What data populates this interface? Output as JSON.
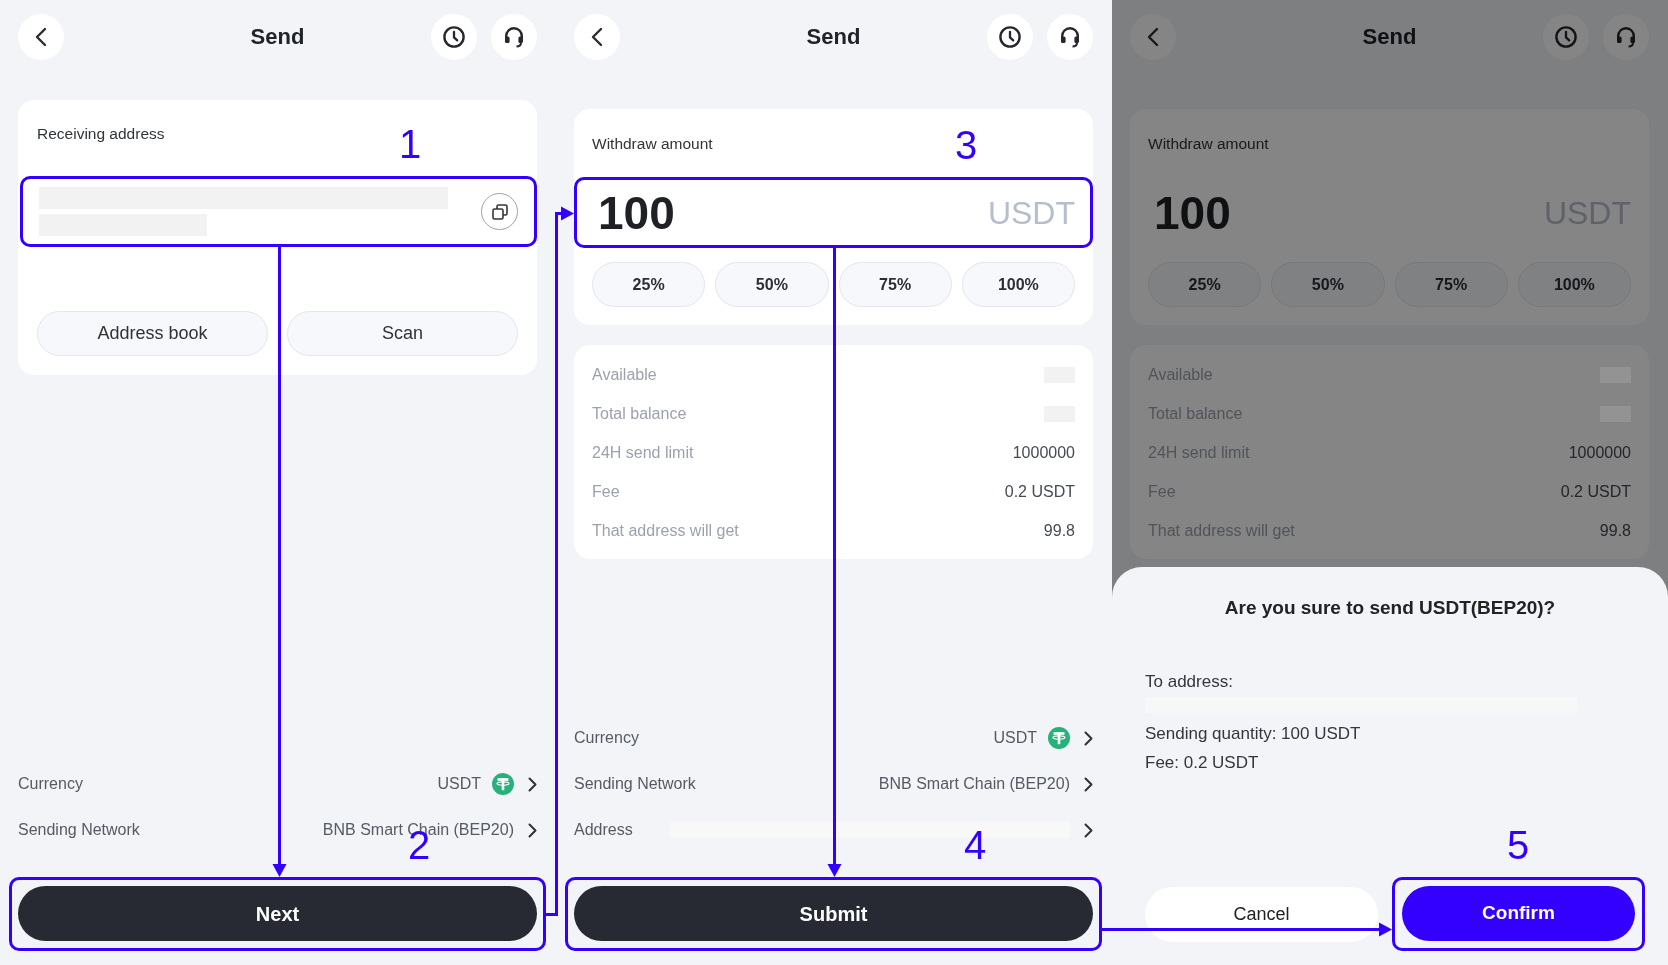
{
  "screens": [
    {
      "dimmed": false,
      "header": {
        "title": "Send"
      },
      "address_card": {
        "label": "Receiving address",
        "field": {
          "redacted": true,
          "step": "1"
        },
        "buttons": [
          "Address book",
          "Scan"
        ]
      },
      "settings": [
        {
          "kind": "coin",
          "label": "Currency",
          "value": "USDT"
        },
        {
          "kind": "text",
          "label": "Sending Network",
          "value": "BNB Smart Chain (BEP20)"
        }
      ],
      "action": {
        "label": "Next",
        "step": "2"
      }
    },
    {
      "dimmed": false,
      "header": {
        "title": "Send"
      },
      "amount_card": {
        "label": "Withdraw amount",
        "value": "100",
        "unit": "USDT",
        "step": "3",
        "presets": [
          "25%",
          "50%",
          "75%",
          "100%"
        ]
      },
      "details": [
        {
          "label": "Available",
          "redacted": true
        },
        {
          "label": "Total balance",
          "redacted": true
        },
        {
          "label": "24H send limit",
          "redacted": false,
          "value": "1000000"
        },
        {
          "label": "Fee",
          "redacted": false,
          "value": "0.2 USDT"
        },
        {
          "label": "That address will get",
          "redacted": false,
          "value": "99.8"
        }
      ],
      "settings": [
        {
          "kind": "coin",
          "label": "Currency",
          "value": "USDT"
        },
        {
          "kind": "text",
          "label": "Sending Network",
          "value": "BNB Smart Chain (BEP20)"
        },
        {
          "kind": "redacted",
          "label": "Address"
        }
      ],
      "action": {
        "label": "Submit",
        "step": "4"
      }
    },
    {
      "dimmed": true,
      "header": {
        "title": "Send"
      },
      "amount_card": {
        "label": "Withdraw amount",
        "value": "100",
        "unit": "USDT",
        "presets": [
          "25%",
          "50%",
          "75%",
          "100%"
        ]
      },
      "details": [
        {
          "label": "Available",
          "redacted": true
        },
        {
          "label": "Total balance",
          "redacted": true
        },
        {
          "label": "24H send limit",
          "redacted": false,
          "value": "1000000"
        },
        {
          "label": "Fee",
          "redacted": false,
          "value": "0.2 USDT"
        },
        {
          "label": "That address will get",
          "redacted": false,
          "value": "99.8"
        }
      ],
      "dialog": {
        "title": "Are you sure to send USDT(BEP20)?",
        "lines": [
          {
            "kind": "text",
            "text": "To address:"
          },
          {
            "kind": "redacted"
          },
          {
            "kind": "text",
            "text": "Sending quantity: 100 USDT"
          },
          {
            "kind": "text",
            "text": "Fee: 0.2 USDT"
          }
        ],
        "buttons": [
          {
            "kind": "secondary",
            "label": "Cancel"
          },
          {
            "kind": "primary",
            "label": "Confirm",
            "step": "5"
          }
        ]
      }
    }
  ]
}
